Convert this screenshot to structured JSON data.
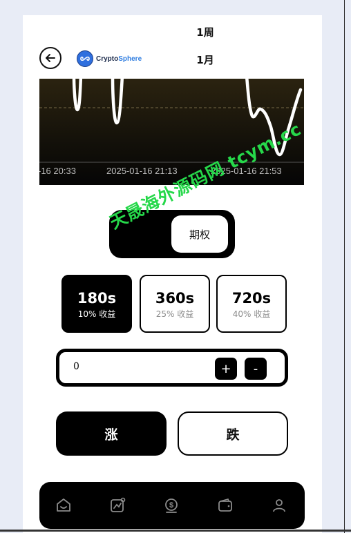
{
  "header": {
    "periods": [
      "1周",
      "1月"
    ],
    "logo": {
      "text_main": "Crypto",
      "text_accent": "Sphere"
    }
  },
  "chart": {
    "tick_labels": [
      "-16 20:33",
      "2025-01-16 21:13",
      "2025-01-16 21:53"
    ]
  },
  "toggle": {
    "active_label": "期权"
  },
  "durations": [
    {
      "duration": "180s",
      "yield": "10% 收益",
      "selected": true
    },
    {
      "duration": "360s",
      "yield": "25% 收益",
      "selected": false
    },
    {
      "duration": "720s",
      "yield": "40% 收益",
      "selected": false
    }
  ],
  "amount": {
    "value": "0",
    "plus_label": "+",
    "minus_label": "-"
  },
  "actions": {
    "rise_label": "涨",
    "fall_label": "跌"
  },
  "nav": {
    "items": [
      "home-icon",
      "market-icon",
      "trade-icon",
      "wallet-icon",
      "profile-icon"
    ]
  },
  "watermark": "天晟海外源码网 tcym.cc",
  "colors": {
    "accent": "#000000",
    "watermark": "#26d84a",
    "logo_blue": "#2f7de0"
  }
}
